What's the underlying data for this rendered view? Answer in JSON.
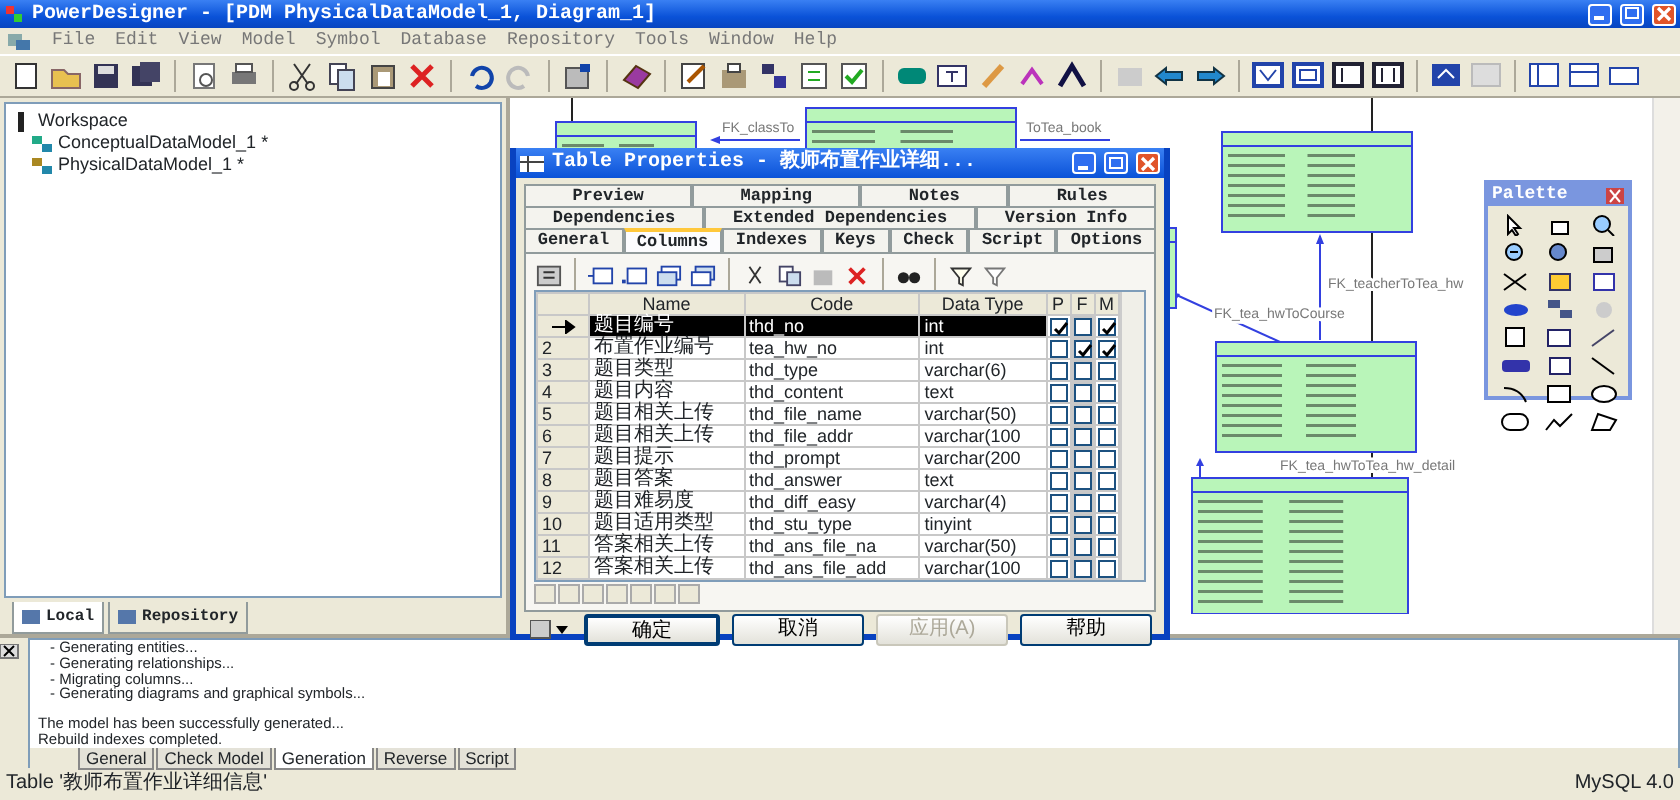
{
  "window": {
    "title": "PowerDesigner - [PDM PhysicalDataModel_1, Diagram_1]"
  },
  "menu": [
    "File",
    "Edit",
    "View",
    "Model",
    "Symbol",
    "Database",
    "Repository",
    "Tools",
    "Window",
    "Help"
  ],
  "browser": {
    "tree": [
      {
        "label": "Workspace",
        "kind": "workspace",
        "children": [
          {
            "label": "ConceptualDataModel_1 *",
            "kind": "cdm"
          },
          {
            "label": "PhysicalDataModel_1 *",
            "kind": "pdm"
          }
        ]
      }
    ],
    "tabs": [
      {
        "label": "Local",
        "selected": true
      },
      {
        "label": "Repository",
        "selected": false
      }
    ]
  },
  "diagram": {
    "links": [
      {
        "label": "FK_classTo"
      },
      {
        "label": "ToTea_book"
      },
      {
        "label": "FK_teacherToTea_hw"
      },
      {
        "label": "FK_tea_hwToCourse"
      },
      {
        "label": "FK_tea_hwToTea_hw_detail"
      }
    ]
  },
  "palette": {
    "title": "Palette"
  },
  "dialog": {
    "title": "Table Properties - 教师布置作业详细...",
    "tab_rows": [
      [
        {
          "label": "Preview",
          "selected": false
        },
        {
          "label": "Mapping",
          "selected": false
        },
        {
          "label": "Notes",
          "selected": false
        },
        {
          "label": "Rules",
          "selected": false
        }
      ],
      [
        {
          "label": "Dependencies",
          "selected": false
        },
        {
          "label": "Extended Dependencies",
          "selected": false
        },
        {
          "label": "Version Info",
          "selected": false
        }
      ],
      [
        {
          "label": "General",
          "selected": false
        },
        {
          "label": "Columns",
          "selected": true
        },
        {
          "label": "Indexes",
          "selected": false
        },
        {
          "label": "Keys",
          "selected": false
        },
        {
          "label": "Check",
          "selected": false
        },
        {
          "label": "Script",
          "selected": false
        },
        {
          "label": "Options",
          "selected": false
        }
      ]
    ],
    "columns": [
      "Name",
      "Code",
      "Data Type",
      "P",
      "F",
      "M"
    ],
    "rows": [
      {
        "name": "题目编号",
        "code": "thd_no",
        "data_type": "int",
        "p": true,
        "f": false,
        "m": true,
        "selected": true
      },
      {
        "number": "2",
        "name": "布置作业编号",
        "code": "tea_hw_no",
        "data_type": "int",
        "p": false,
        "f": true,
        "m": true,
        "selected": false
      },
      {
        "number": "3",
        "name": "题目类型",
        "code": "thd_type",
        "data_type": "varchar(6)",
        "p": false,
        "f": false,
        "m": false,
        "selected": false
      },
      {
        "number": "4",
        "name": "题目内容",
        "code": "thd_content",
        "data_type": "text",
        "p": false,
        "f": false,
        "m": false,
        "selected": false
      },
      {
        "number": "5",
        "name": "题目相关上传",
        "code": "thd_file_name",
        "data_type": "varchar(50)",
        "p": false,
        "f": false,
        "m": false,
        "selected": false
      },
      {
        "number": "6",
        "name": "题目相关上传",
        "code": "thd_file_addr",
        "data_type": "varchar(100",
        "p": false,
        "f": false,
        "m": false,
        "selected": false
      },
      {
        "number": "7",
        "name": "题目提示",
        "code": "thd_prompt",
        "data_type": "varchar(200",
        "p": false,
        "f": false,
        "m": false,
        "selected": false
      },
      {
        "number": "8",
        "name": "题目答案",
        "code": "thd_answer",
        "data_type": "text",
        "p": false,
        "f": false,
        "m": false,
        "selected": false
      },
      {
        "number": "9",
        "name": "题目难易度",
        "code": "thd_diff_easy",
        "data_type": "varchar(4)",
        "p": false,
        "f": false,
        "m": false,
        "selected": false
      },
      {
        "number": "10",
        "name": "题目适用类型",
        "code": "thd_stu_type",
        "data_type": "tinyint",
        "p": false,
        "f": false,
        "m": false,
        "selected": false
      },
      {
        "number": "11",
        "name": "答案相关上传",
        "code": "thd_ans_file_na",
        "data_type": "varchar(50)",
        "p": false,
        "f": false,
        "m": false,
        "selected": false
      },
      {
        "number": "12",
        "name": "答案相关上传",
        "code": "thd_ans_file_add",
        "data_type": "varchar(100",
        "p": false,
        "f": false,
        "m": false,
        "selected": false
      }
    ],
    "buttons": [
      {
        "label": "确定",
        "disabled": false
      },
      {
        "label": "取消",
        "disabled": false
      },
      {
        "label": "应用(A)",
        "disabled": true
      },
      {
        "label": "帮助",
        "disabled": false
      }
    ]
  },
  "output": {
    "lines": [
      "- Generating entities...",
      "- Generating relationships...",
      "- Migrating columns...",
      "- Generating diagrams and graphical symbols...",
      "The model has been successfully generated...",
      "Rebuild indexes completed."
    ],
    "tabs": [
      {
        "label": "General",
        "selected": false
      },
      {
        "label": "Check Model",
        "selected": false
      },
      {
        "label": "Generation",
        "selected": true
      },
      {
        "label": "Reverse",
        "selected": false
      },
      {
        "label": "Script",
        "selected": false
      }
    ]
  },
  "status_bar": {
    "message": "Table '教师布置作业详细信息'",
    "dbms": "MySQL 4.0"
  }
}
